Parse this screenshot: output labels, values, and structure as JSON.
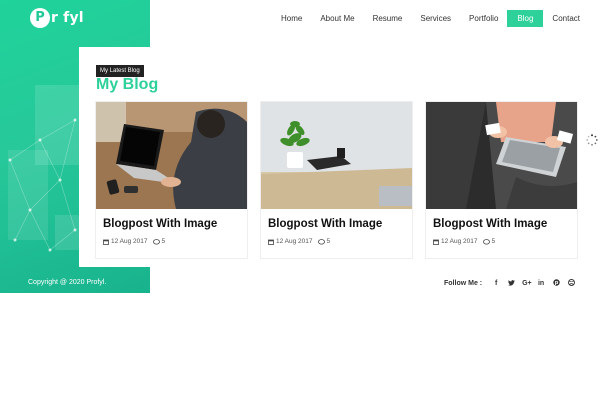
{
  "logo": {
    "badge": "P",
    "text": "r fyl"
  },
  "nav": {
    "items": [
      "Home",
      "About Me",
      "Resume",
      "Services",
      "Portfolio",
      "Blog",
      "Contact"
    ],
    "active_index": 5
  },
  "section": {
    "tag": "My Latest Blog",
    "title": "My Blog"
  },
  "posts": [
    {
      "title": "Blogpost With Image",
      "date": "12 Aug 2017",
      "comments": "5"
    },
    {
      "title": "Blogpost With Image",
      "date": "12 Aug 2017",
      "comments": "5"
    },
    {
      "title": "Blogpost With Image",
      "date": "12 Aug 2017",
      "comments": "5"
    }
  ],
  "footer": {
    "copyright": "Copyright @ 2020 Profyl.",
    "follow_label": "Follow Me :",
    "social": [
      {
        "icon": "facebook-icon",
        "glyph": "f"
      },
      {
        "icon": "twitter-icon",
        "glyph": "🐦"
      },
      {
        "icon": "google-plus-icon",
        "glyph": "G+"
      },
      {
        "icon": "linkedin-icon",
        "glyph": "in"
      },
      {
        "icon": "pinterest-icon",
        "glyph": "℗"
      },
      {
        "icon": "dribbble-icon",
        "glyph": "⊛"
      }
    ]
  },
  "colors": {
    "accent": "#2fd19a",
    "dark": "#222222"
  }
}
